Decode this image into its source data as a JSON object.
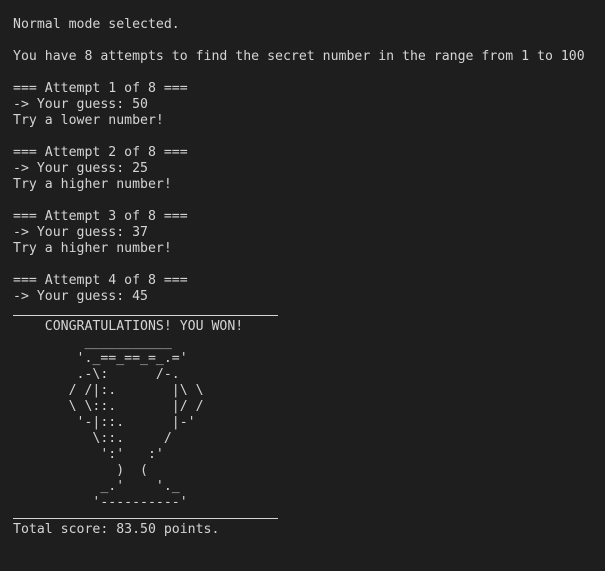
{
  "terminal": {
    "mode_line": "Normal mode selected.",
    "intro_line": "You have 8 attempts to find the secret number in the range from 1 to 100",
    "attempts": [
      {
        "header": "=== Attempt 1 of 8 ===",
        "guess": "-> Your guess: 50",
        "hint": "Try a lower number!"
      },
      {
        "header": "=== Attempt 2 of 8 ===",
        "guess": "-> Your guess: 25",
        "hint": "Try a higher number!"
      },
      {
        "header": "=== Attempt 3 of 8 ===",
        "guess": "-> Your guess: 37",
        "hint": "Try a higher number!"
      },
      {
        "header": "=== Attempt 4 of 8 ===",
        "guess": "-> Your guess: 45"
      }
    ],
    "win_message": "    CONGRATULATIONS! YOU WON!",
    "trophy_art": "         ___________\n        '._==_==_=_.='\n        .-\\:      /-.\n       / /|:.       |\\ \\\n       \\ \\::.       |/ /\n        '-|::.      |-'\n          \\::.     /\n           ':'   :'\n             )  (\n           _.'    '._\n          '----------'",
    "score_line": "Total score: 83.50 points."
  },
  "colors": {
    "background": "#1e1e1e",
    "foreground": "#d4d4d4"
  }
}
